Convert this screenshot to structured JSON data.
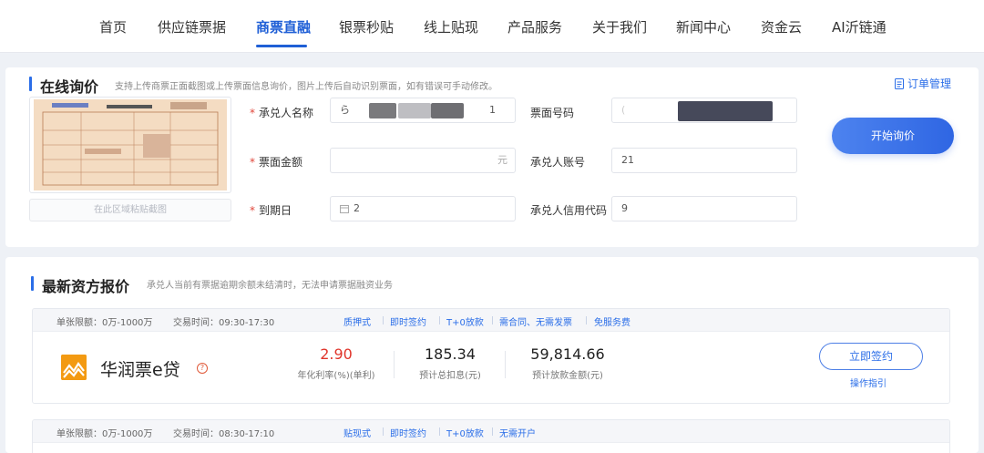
{
  "nav": {
    "items": [
      "首页",
      "供应链票据",
      "商票直融",
      "银票秒贴",
      "线上贴现",
      "产品服务",
      "关于我们",
      "新闻中心",
      "资金云",
      "AI沂链通"
    ],
    "active_index": 2,
    "accent": "#1f5fd6"
  },
  "inquiry": {
    "title": "在线询价",
    "desc": "支持上传商票正面截图或上传票面信息询价，图片上传后自动识别票面，如有错误可手动修改。",
    "order_link": "订单管理",
    "paste_hint": "在此区域粘贴截图",
    "fields": {
      "acceptor_name": {
        "label": "承兑人名称",
        "value": "ら",
        "suffix": "1"
      },
      "amount": {
        "label": "票面金额",
        "unit": "元"
      },
      "due_date": {
        "label": "到期日",
        "value": "2"
      },
      "bill_no": {
        "label": "票面号码",
        "value": "("
      },
      "account_no": {
        "label": "承兑人账号",
        "value": "21"
      },
      "credit_code": {
        "label": "承兑人信用代码",
        "value": "9"
      }
    },
    "submit": "开始询价"
  },
  "quotes": {
    "title": "最新资方报价",
    "desc": "承兑人当前有票据逾期余额未结清时，无法申请票据融资业务",
    "offers": [
      {
        "limit": "单张限额：0万-1000万",
        "hours": "交易时间：09:30-17:30",
        "tags": [
          "质押式",
          "即时签约",
          "T+0放款",
          "需合同、无需发票",
          "免服务费"
        ],
        "brand": "华润票e贷",
        "rate": "2.90",
        "rate_label": "年化利率(%)(单利)",
        "interest": "185.34",
        "interest_label": "预计总扣息(元)",
        "loan": "59,814.66",
        "loan_label": "预计放款金额(元)",
        "cta": "立即签约",
        "guide": "操作指引"
      },
      {
        "limit": "单张限额：0万-1000万",
        "hours": "交易时间：08:30-17:10",
        "tags": [
          "贴现式",
          "即时签约",
          "T+0放款",
          "无需开户"
        ]
      }
    ]
  }
}
